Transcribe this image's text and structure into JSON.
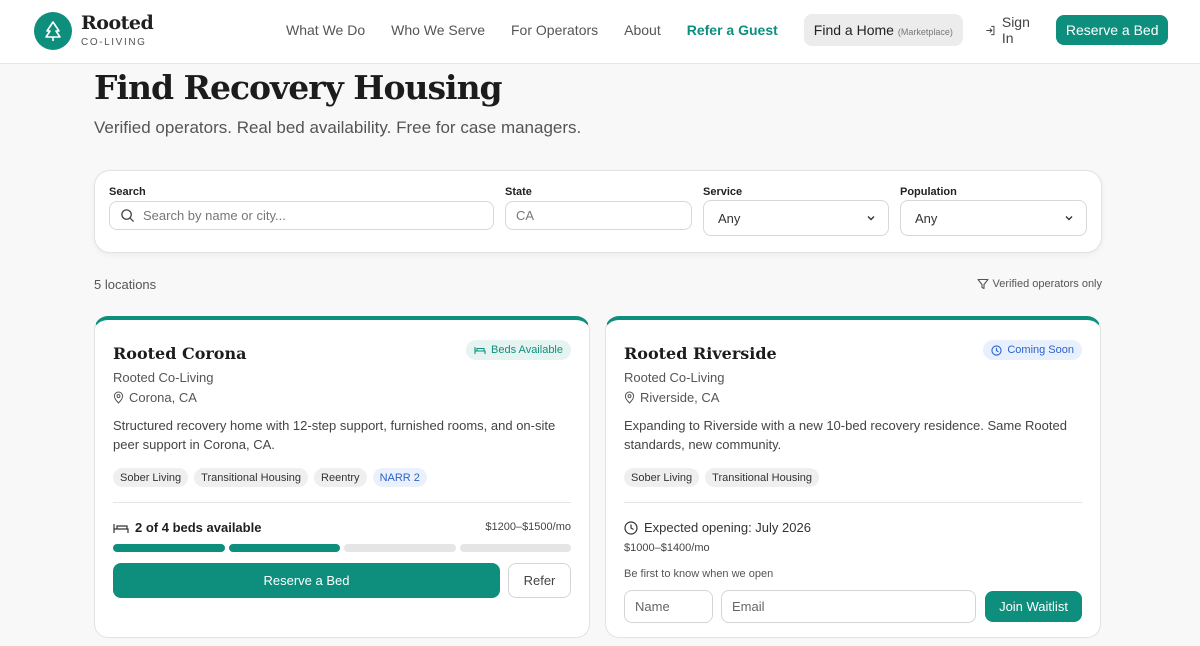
{
  "brand": {
    "name": "Rooted",
    "sub": "CO-LIVING"
  },
  "nav": {
    "links": [
      "What We Do",
      "Who We Serve",
      "For Operators",
      "About"
    ],
    "refer": "Refer a Guest",
    "find": "Find a Home",
    "find_note": "(Marketplace)",
    "signin": "Sign In",
    "reserve": "Reserve a Bed"
  },
  "hero": {
    "title": "Find Recovery Housing",
    "subtitle": "Verified operators. Real bed availability. Free for case managers."
  },
  "filters": {
    "search_label": "Search",
    "search_placeholder": "Search by name or city...",
    "state_label": "State",
    "state_value": "CA",
    "service_label": "Service",
    "service_value": "Any",
    "population_label": "Population",
    "population_value": "Any"
  },
  "results": {
    "count": "5 locations",
    "verified": "Verified operators only"
  },
  "cards": [
    {
      "title": "Rooted Corona",
      "operator": "Rooted Co-Living",
      "location": "Corona, CA",
      "badge": "Beds Available",
      "description": "Structured recovery home with 12-step support, furnished rooms, and on-site peer support in Corona, CA.",
      "tags": [
        "Sober Living",
        "Transitional Housing",
        "Reentry",
        "NARR 2"
      ],
      "beds_text": "2 of 4 beds available",
      "beds_filled": 2,
      "beds_total": 4,
      "price": "$1200–$1500/mo",
      "reserve": "Reserve a Bed",
      "refer": "Refer"
    },
    {
      "title": "Rooted Riverside",
      "operator": "Rooted Co-Living",
      "location": "Riverside, CA",
      "badge": "Coming Soon",
      "description": "Expanding to Riverside with a new 10-bed recovery residence. Same Rooted standards, new community.",
      "tags": [
        "Sober Living",
        "Transitional Housing"
      ],
      "opening": "Expected opening: July 2026",
      "price": "$1000–$1400/mo",
      "notify": "Be first to know when we open",
      "name_placeholder": "Name",
      "email_placeholder": "Email",
      "waitlist": "Join Waitlist"
    }
  ],
  "colors": {
    "accent": "#0e8f7e",
    "blue": "#2b63c8"
  }
}
